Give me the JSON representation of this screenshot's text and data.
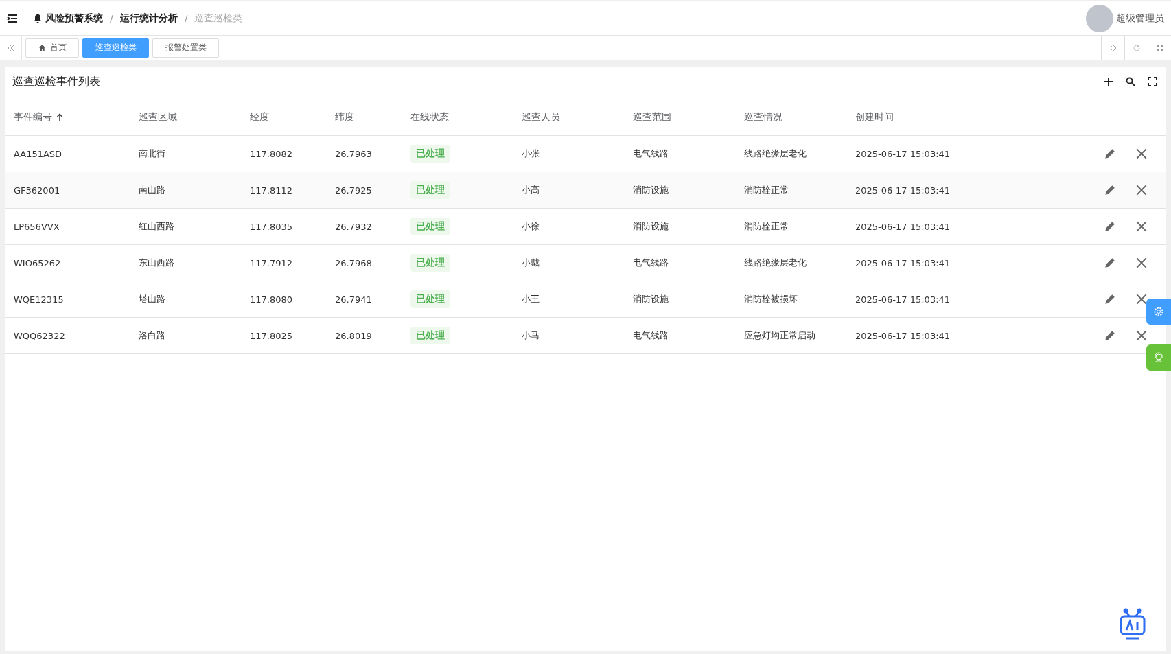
{
  "breadcrumb_separator": "/",
  "breadcrumb": [
    {
      "label": "风险预警系统",
      "current": false
    },
    {
      "label": "运行统计分析",
      "current": false
    },
    {
      "label": "巡查巡检类",
      "current": true
    }
  ],
  "user": {
    "name": "超级管理员"
  },
  "tabs": [
    {
      "label": "首页",
      "kind": "home",
      "selected": false
    },
    {
      "label": "巡查巡检类",
      "kind": "page",
      "selected": true
    },
    {
      "label": "报警处置类",
      "kind": "page",
      "selected": false
    }
  ],
  "panel": {
    "title": "巡查巡检事件列表"
  },
  "table": {
    "columns": [
      {
        "label": "事件编号",
        "sorted": true
      },
      {
        "label": "巡查区域",
        "sorted": false
      },
      {
        "label": "经度",
        "sorted": false
      },
      {
        "label": "纬度",
        "sorted": false
      },
      {
        "label": "在线状态",
        "sorted": false
      },
      {
        "label": "巡查人员",
        "sorted": false
      },
      {
        "label": "巡查范围",
        "sorted": false
      },
      {
        "label": "巡查情况",
        "sorted": false
      },
      {
        "label": "创建时间",
        "sorted": false
      }
    ],
    "rows": [
      {
        "id": "AA151ASD",
        "area": "南北街",
        "lng": "117.8082",
        "lat": "26.7963",
        "status": "已处理",
        "person": "小张",
        "scope": "电气线路",
        "situation": "线路绝缘层老化",
        "created": "2025-06-17 15:03:41"
      },
      {
        "id": "GF362001",
        "area": "南山路",
        "lng": "117.8112",
        "lat": "26.7925",
        "status": "已处理",
        "person": "小高",
        "scope": "消防设施",
        "situation": "消防栓正常",
        "created": "2025-06-17 15:03:41"
      },
      {
        "id": "LP656VVX",
        "area": "红山西路",
        "lng": "117.8035",
        "lat": "26.7932",
        "status": "已处理",
        "person": "小徐",
        "scope": "消防设施",
        "situation": "消防栓正常",
        "created": "2025-06-17 15:03:41"
      },
      {
        "id": "WIO65262",
        "area": "东山西路",
        "lng": "117.7912",
        "lat": "26.7968",
        "status": "已处理",
        "person": "小戴",
        "scope": "电气线路",
        "situation": "线路绝缘层老化",
        "created": "2025-06-17 15:03:41"
      },
      {
        "id": "WQE12315",
        "area": "塔山路",
        "lng": "117.8080",
        "lat": "26.7941",
        "status": "已处理",
        "person": "小王",
        "scope": "消防设施",
        "situation": "消防栓被损坏",
        "created": "2025-06-17 15:03:41"
      },
      {
        "id": "WQQ62322",
        "area": "洛白路",
        "lng": "117.8025",
        "lat": "26.8019",
        "status": "已处理",
        "person": "小马",
        "scope": "电气线路",
        "situation": "应急灯均正常启动",
        "created": "2025-06-17 15:03:41"
      }
    ]
  }
}
